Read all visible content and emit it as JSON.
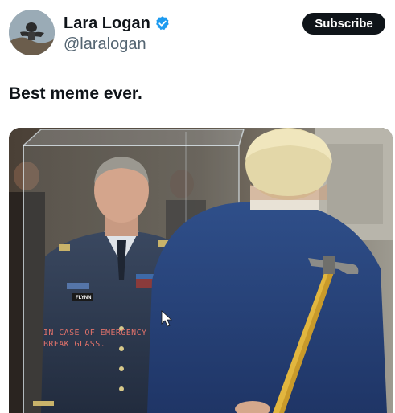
{
  "author": {
    "display_name": "Lara Logan",
    "handle": "@laralogan",
    "verified": true,
    "verified_icon": "verified-badge-icon",
    "verified_color": "#1d9bf0"
  },
  "actions": {
    "subscribe_label": "Subscribe"
  },
  "post": {
    "text": "Best meme ever."
  },
  "media": {
    "caption_line1": "IN CASE OF EMERGENCY",
    "caption_line2": "BREAK GLASS.",
    "name_tag": "FLYNN"
  },
  "colors": {
    "text_primary": "#0f1419",
    "text_secondary": "#536471",
    "button_bg": "#0f1419",
    "button_text": "#ffffff",
    "caption": "#e0726a"
  }
}
